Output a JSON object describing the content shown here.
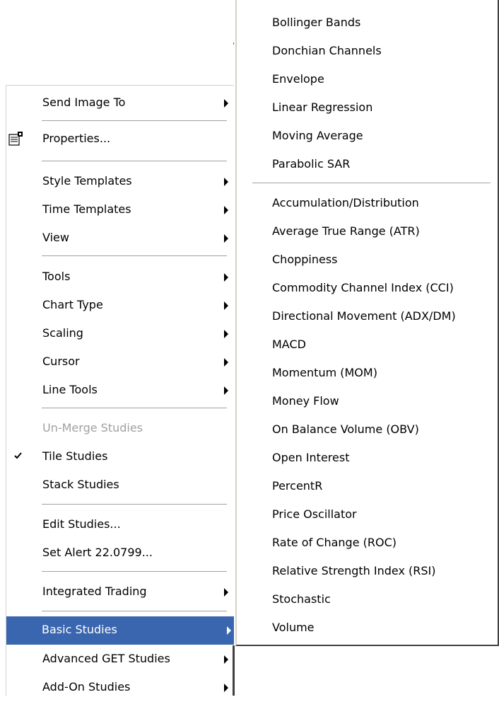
{
  "colors": {
    "menu_background": "#ffffff",
    "highlight": "#3a66b0",
    "disabled_text": "#a0a0a0",
    "separator": "#a0a0a0"
  },
  "main_menu": {
    "items": [
      {
        "label": "Send Image To",
        "has_submenu": true
      },
      {
        "label": "Properties...",
        "icon": "properties-icon"
      },
      {
        "label": "Style Templates",
        "has_submenu": true
      },
      {
        "label": "Time Templates",
        "has_submenu": true
      },
      {
        "label": "View",
        "has_submenu": true
      },
      {
        "label": "Tools",
        "has_submenu": true
      },
      {
        "label": "Chart Type",
        "has_submenu": true
      },
      {
        "label": "Scaling",
        "has_submenu": true
      },
      {
        "label": "Cursor",
        "has_submenu": true
      },
      {
        "label": "Line Tools",
        "has_submenu": true
      },
      {
        "label": "Un-Merge Studies",
        "disabled": true
      },
      {
        "label": "Tile Studies",
        "checked": true
      },
      {
        "label": "Stack Studies"
      },
      {
        "label": "Edit Studies..."
      },
      {
        "label": "Set Alert 22.0799..."
      },
      {
        "label": "Integrated Trading",
        "has_submenu": true
      },
      {
        "label": "Basic Studies",
        "has_submenu": true,
        "highlighted": true
      },
      {
        "label": "Advanced GET Studies",
        "has_submenu": true
      },
      {
        "label": "Add-On Studies",
        "has_submenu": true
      }
    ]
  },
  "sub_menu": {
    "items": [
      {
        "label": "Bollinger Bands"
      },
      {
        "label": "Donchian Channels"
      },
      {
        "label": "Envelope"
      },
      {
        "label": "Linear Regression"
      },
      {
        "label": "Moving Average"
      },
      {
        "label": "Parabolic SAR"
      },
      {
        "label": "Accumulation/Distribution"
      },
      {
        "label": "Average True Range (ATR)"
      },
      {
        "label": "Choppiness"
      },
      {
        "label": "Commodity Channel Index (CCI)"
      },
      {
        "label": "Directional Movement (ADX/DM)"
      },
      {
        "label": "MACD"
      },
      {
        "label": "Momentum (MOM)"
      },
      {
        "label": "Money Flow"
      },
      {
        "label": "On Balance Volume (OBV)"
      },
      {
        "label": "Open Interest"
      },
      {
        "label": "PercentR"
      },
      {
        "label": "Price Oscillator"
      },
      {
        "label": "Rate of Change (ROC)"
      },
      {
        "label": "Relative Strength Index (RSI)"
      },
      {
        "label": "Stochastic"
      },
      {
        "label": "Volume"
      }
    ]
  }
}
